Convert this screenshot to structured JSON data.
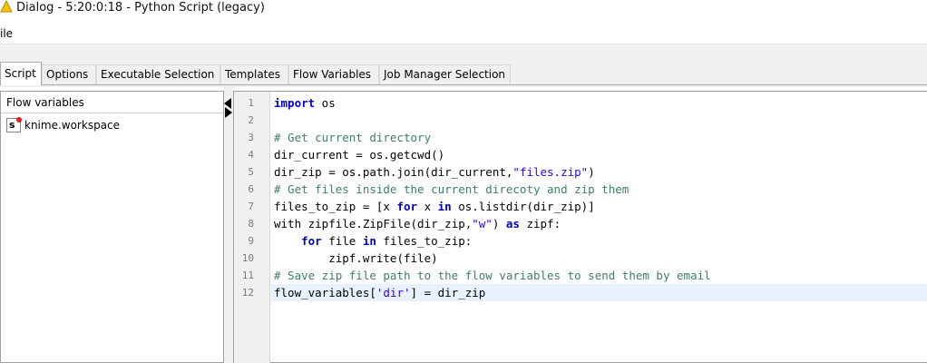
{
  "window": {
    "title": "Dialog - 5:20:0:18 - Python Script (legacy)"
  },
  "menu": {
    "file": "ile"
  },
  "tabs": [
    {
      "label": "Script",
      "active": true
    },
    {
      "label": "Options"
    },
    {
      "label": "Executable Selection"
    },
    {
      "label": "Templates"
    },
    {
      "label": "Flow Variables"
    },
    {
      "label": "Job Manager Selection"
    }
  ],
  "flow_panel": {
    "header": "Flow variables",
    "items": [
      {
        "icon": "s",
        "label": "knime.workspace"
      }
    ]
  },
  "editor": {
    "line_numbers": [
      "1",
      "2",
      "3",
      "4",
      "5",
      "6",
      "7",
      "8",
      "9",
      "10",
      "11",
      "12"
    ],
    "current_line": 12,
    "lines": [
      [
        {
          "t": "kw",
          "v": "import"
        },
        {
          "t": "n",
          "v": " os"
        }
      ],
      [],
      [
        {
          "t": "cm",
          "v": "# Get current directory"
        }
      ],
      [
        {
          "t": "n",
          "v": "dir_current = os.getcwd()"
        }
      ],
      [
        {
          "t": "n",
          "v": "dir_zip = os.path.join(dir_current,"
        },
        {
          "t": "st",
          "v": "\"files.zip\""
        },
        {
          "t": "n",
          "v": ")"
        }
      ],
      [
        {
          "t": "cm",
          "v": "# Get files inside the current direcoty and zip them"
        }
      ],
      [
        {
          "t": "n",
          "v": "files_to_zip = [x "
        },
        {
          "t": "kw",
          "v": "for"
        },
        {
          "t": "n",
          "v": " x "
        },
        {
          "t": "kw",
          "v": "in"
        },
        {
          "t": "n",
          "v": " os.listdir(dir_zip)]"
        }
      ],
      [
        {
          "t": "n",
          "v": "with zipfile.ZipFile(dir_zip,"
        },
        {
          "t": "st",
          "v": "\"w\""
        },
        {
          "t": "n",
          "v": ") "
        },
        {
          "t": "kw",
          "v": "as"
        },
        {
          "t": "n",
          "v": " zipf:"
        }
      ],
      [
        {
          "t": "n",
          "v": "    "
        },
        {
          "t": "kw",
          "v": "for"
        },
        {
          "t": "n",
          "v": " file "
        },
        {
          "t": "kw",
          "v": "in"
        },
        {
          "t": "n",
          "v": " files_to_zip:"
        }
      ],
      [
        {
          "t": "n",
          "v": "        zipf.write(file)"
        }
      ],
      [
        {
          "t": "cm",
          "v": "# Save zip file path to the flow variables to send them by email"
        }
      ],
      [
        {
          "t": "n",
          "v": "flow_variables["
        },
        {
          "t": "st",
          "v": "'dir'"
        },
        {
          "t": "n",
          "v": "] = dir_zip"
        }
      ]
    ]
  },
  "colors": {
    "keyword": "#0000cc",
    "comment": "#3f7f5f",
    "string": "#2a00ff",
    "current_line": "#e8f2fe",
    "warning_icon": "#f5c400"
  }
}
